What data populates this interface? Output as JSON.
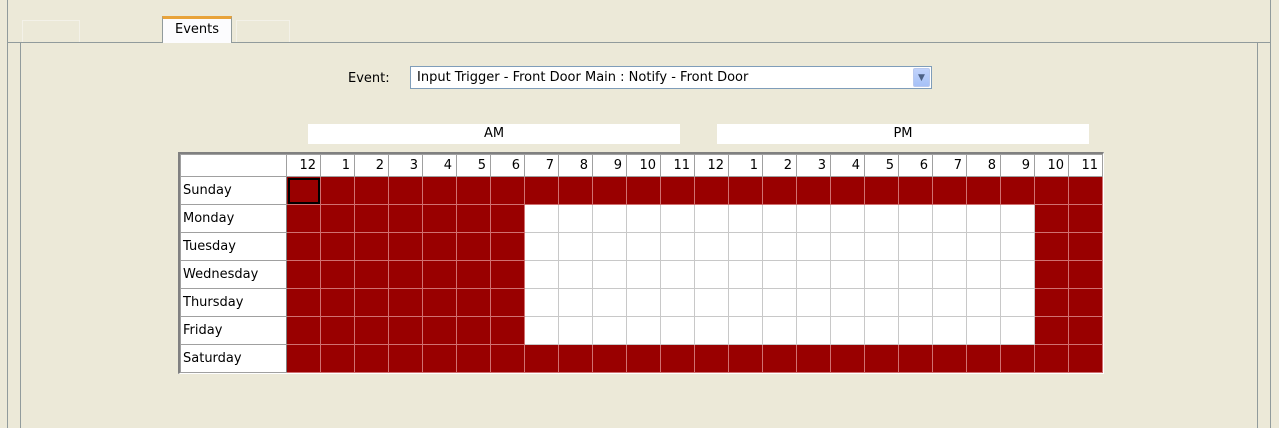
{
  "tabs": [
    {
      "label": "Events"
    }
  ],
  "event": {
    "label": "Event:",
    "selected": "Input Trigger - Front Door Main : Notify - Front Door"
  },
  "schedule": {
    "am_label": "AM",
    "pm_label": "PM",
    "hours": [
      "12",
      "1",
      "2",
      "3",
      "4",
      "5",
      "6",
      "7",
      "8",
      "9",
      "10",
      "11",
      "12",
      "1",
      "2",
      "3",
      "4",
      "5",
      "6",
      "7",
      "8",
      "9",
      "10",
      "11"
    ],
    "active_color": "#990000",
    "inactive_color": "#ffffff",
    "days": [
      {
        "name": "Sunday",
        "active": [
          1,
          1,
          1,
          1,
          1,
          1,
          1,
          1,
          1,
          1,
          1,
          1,
          1,
          1,
          1,
          1,
          1,
          1,
          1,
          1,
          1,
          1,
          1,
          1
        ]
      },
      {
        "name": "Monday",
        "active": [
          1,
          1,
          1,
          1,
          1,
          1,
          1,
          0,
          0,
          0,
          0,
          0,
          0,
          0,
          0,
          0,
          0,
          0,
          0,
          0,
          0,
          0,
          1,
          1
        ]
      },
      {
        "name": "Tuesday",
        "active": [
          1,
          1,
          1,
          1,
          1,
          1,
          1,
          0,
          0,
          0,
          0,
          0,
          0,
          0,
          0,
          0,
          0,
          0,
          0,
          0,
          0,
          0,
          1,
          1
        ]
      },
      {
        "name": "Wednesday",
        "active": [
          1,
          1,
          1,
          1,
          1,
          1,
          1,
          0,
          0,
          0,
          0,
          0,
          0,
          0,
          0,
          0,
          0,
          0,
          0,
          0,
          0,
          0,
          1,
          1
        ]
      },
      {
        "name": "Thursday",
        "active": [
          1,
          1,
          1,
          1,
          1,
          1,
          1,
          0,
          0,
          0,
          0,
          0,
          0,
          0,
          0,
          0,
          0,
          0,
          0,
          0,
          0,
          0,
          1,
          1
        ]
      },
      {
        "name": "Friday",
        "active": [
          1,
          1,
          1,
          1,
          1,
          1,
          1,
          0,
          0,
          0,
          0,
          0,
          0,
          0,
          0,
          0,
          0,
          0,
          0,
          0,
          0,
          0,
          1,
          1
        ]
      },
      {
        "name": "Saturday",
        "active": [
          1,
          1,
          1,
          1,
          1,
          1,
          1,
          1,
          1,
          1,
          1,
          1,
          1,
          1,
          1,
          1,
          1,
          1,
          1,
          1,
          1,
          1,
          1,
          1
        ]
      }
    ]
  }
}
